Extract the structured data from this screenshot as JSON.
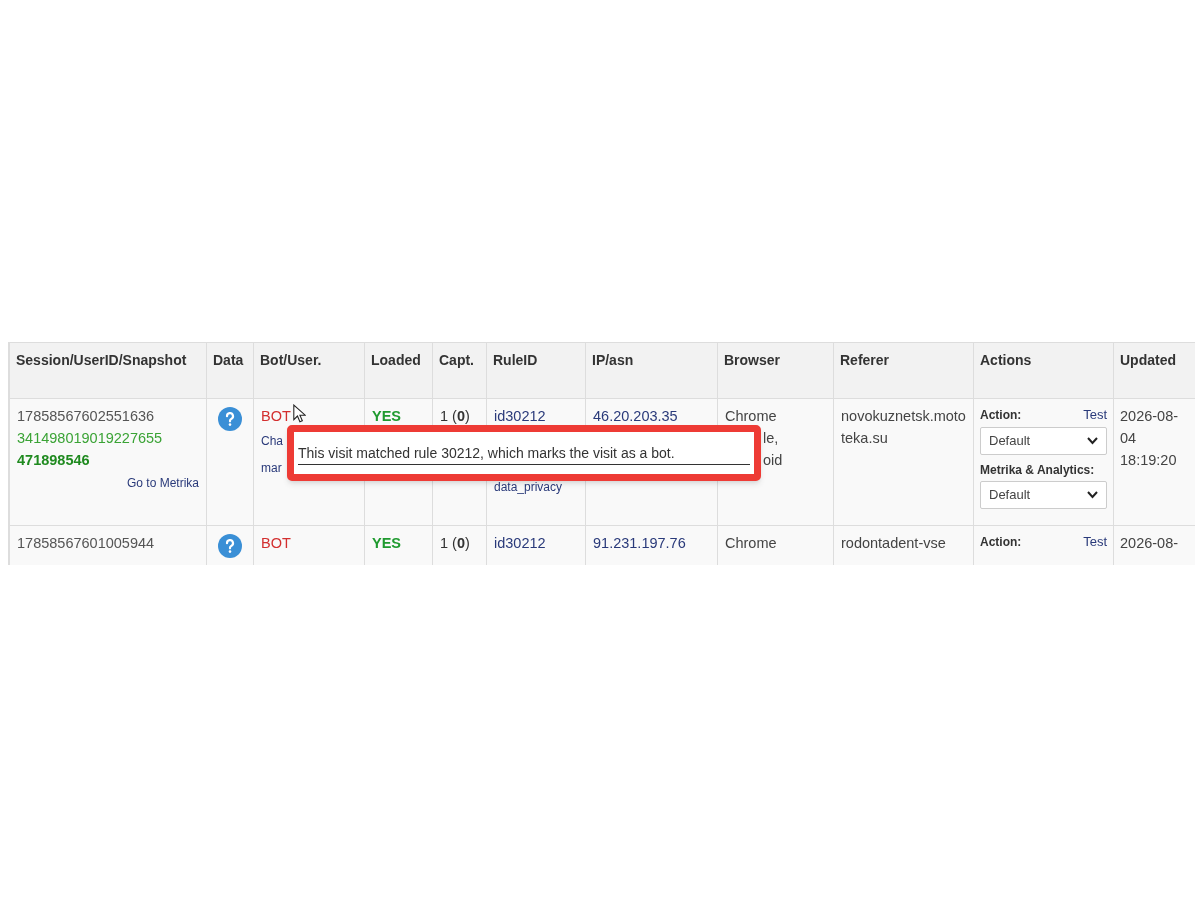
{
  "table": {
    "columns": [
      "Session/UserID/Snapshot",
      "Data",
      "Bot/User.",
      "Loaded",
      "Capt.",
      "RuleID",
      "IP/asn",
      "Browser",
      "Referer",
      "Actions",
      "Updated"
    ],
    "rows": [
      {
        "session": [
          "17858567602551636",
          "341498019019227655",
          "471898546"
        ],
        "metrika_link": "Go to Metrika",
        "bot": "BOT",
        "bot_lines": [
          "Cha",
          "mar"
        ],
        "loaded": "YES",
        "capt": "1 (**0**)",
        "rule": "id30212",
        "rule_note": "data_privacy",
        "ip": "46.20.203.35",
        "browser": [
          "Chrome"
        ],
        "browser_tail": [
          "le,",
          "oid"
        ],
        "referer": "novokuznetsk.mototeka.su",
        "action_label": "Action:",
        "test_link": "Test",
        "action_select": "Default",
        "metrika_label": "Metrika & Analytics:",
        "metrika_select": "Default",
        "updated": "2026-08-04 18:19:20"
      },
      {
        "session": [
          "17858567601005944"
        ],
        "bot": "BOT",
        "bot_lines": [],
        "loaded": "YES",
        "capt": "1 (**0**)",
        "rule": "id30212",
        "ip": "91.231.197.76",
        "browser": [
          "Chrome"
        ],
        "browser_tail": [],
        "referer": "rodontadent-vse",
        "action_label": "Action:",
        "test_link": "Test",
        "updated": "2026-08-"
      }
    ]
  },
  "tooltip": {
    "text": "This visit matched rule 30212, which marks the visit as a bot."
  }
}
